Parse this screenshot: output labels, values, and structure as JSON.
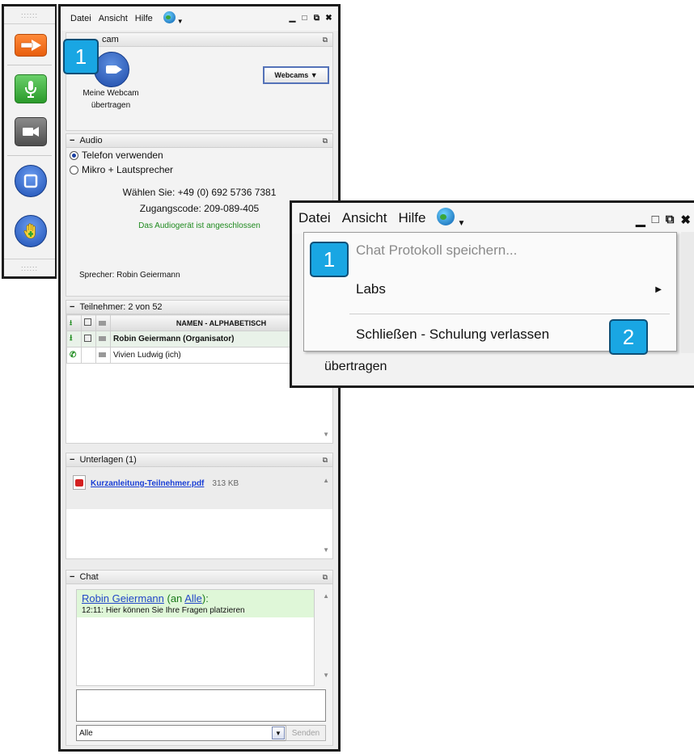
{
  "menu": {
    "datei": "Datei",
    "ansicht": "Ansicht",
    "hilfe": "Hilfe"
  },
  "window_controls": {
    "minimize": "▁",
    "maximize": "□",
    "popout": "⧉",
    "close": "✖"
  },
  "webcam": {
    "title": "cam",
    "label_line1": "Meine Webcam",
    "label_line2": "übertragen",
    "button": "Webcams ▼"
  },
  "audio": {
    "title": "Audio",
    "options": [
      "Telefon verwenden",
      "Mikro + Lautsprecher"
    ],
    "dial": "Wählen Sie: +49 (0) 692 5736 7381",
    "code": "Zugangscode: 209-089-405",
    "status": "Das Audiogerät ist angeschlossen",
    "speaker": "Sprecher: Robin Geiermann"
  },
  "participants": {
    "title": "Teilnehmer: 2 von 52",
    "column_names": "NAMEN - ALPHABETISCH",
    "rows": [
      {
        "name": "Robin Geiermann (Organisator)"
      },
      {
        "name": "Vivien Ludwig (ich)"
      }
    ]
  },
  "documents": {
    "title": "Unterlagen (1)",
    "file": "Kurzanleitung-Teilnehmer.pdf",
    "size": "313 KB"
  },
  "chat": {
    "title": "Chat",
    "from_name": "Robin Geiermann",
    "to_prefix": " (an ",
    "to_name": "Alle",
    "to_suffix": "):",
    "message": "12:11: Hier können Sie Ihre Fragen platzieren",
    "recipient": "Alle",
    "send": "Senden"
  },
  "popup": {
    "items": [
      "Chat Protokoll speichern...",
      "Labs",
      "Schließen - Schulung verlassen"
    ],
    "underlying_text": "übertragen"
  },
  "badges": {
    "one": "1",
    "two": "2"
  },
  "colors": {
    "badge": "#19a6e3",
    "link": "#1a3fd6",
    "status_green": "#1f8a1f",
    "chat_bg": "#dff7d8"
  }
}
